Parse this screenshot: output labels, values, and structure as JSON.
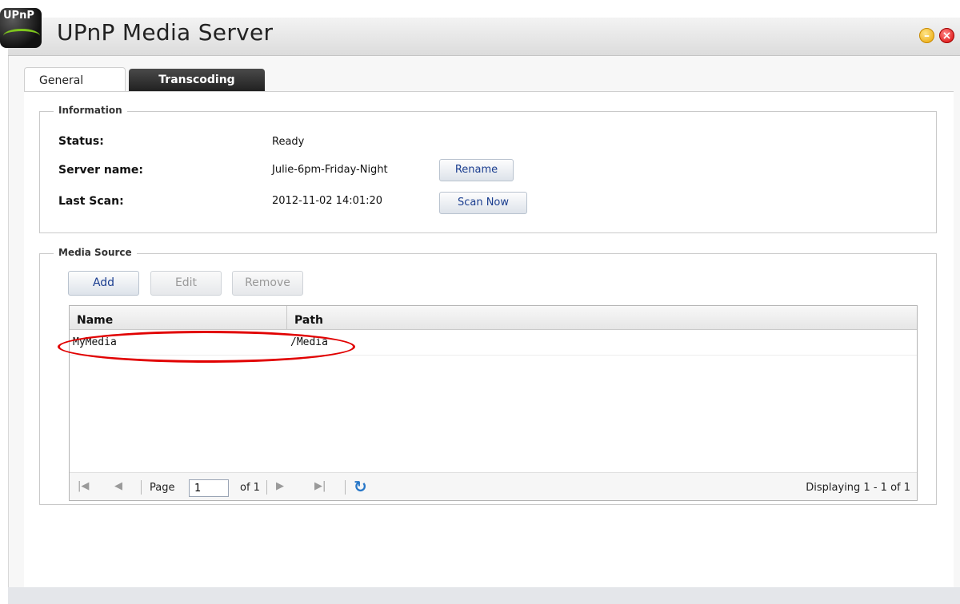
{
  "window": {
    "title": "UPnP Media Server",
    "logo_text": "UPnP"
  },
  "tabs": [
    {
      "label": "General",
      "active": true
    },
    {
      "label": "Transcoding",
      "active": false
    }
  ],
  "information": {
    "legend": "Information",
    "status_label": "Status:",
    "status_value": "Ready",
    "server_name_label": "Server name:",
    "server_name_value": "Julie-6pm-Friday-Night",
    "rename_button": "Rename",
    "last_scan_label": "Last Scan:",
    "last_scan_value": "2012-11-02 14:01:20",
    "scan_now_button": "Scan Now"
  },
  "media_source": {
    "legend": "Media Source",
    "add_button": "Add",
    "edit_button": "Edit",
    "remove_button": "Remove",
    "columns": [
      "Name",
      "Path"
    ],
    "rows": [
      {
        "name": "MyMedia",
        "path": "/Media"
      }
    ],
    "pager": {
      "page_label": "Page",
      "page_value": "1",
      "of_label": "of 1",
      "display_info": "Displaying 1 - 1 of 1"
    }
  },
  "colors": {
    "highlight": "#e10000",
    "button_text": "#1a3d8f",
    "tab_active_bg": "#ffffff",
    "tab_inactive_bg": "#2a2a2a"
  }
}
